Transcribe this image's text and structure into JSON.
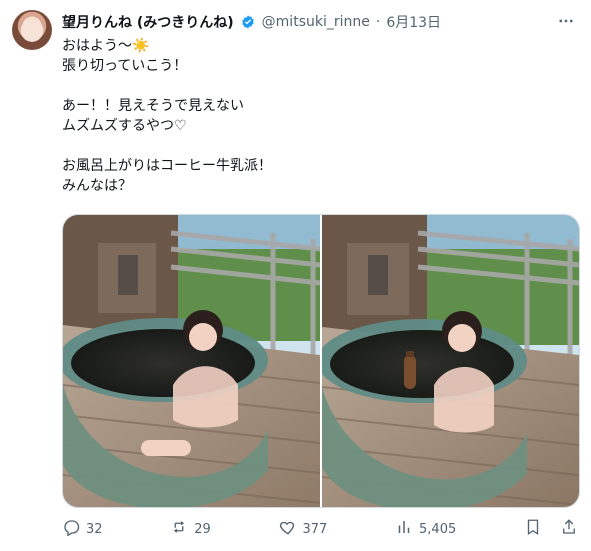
{
  "tweet": {
    "author_name": "望月りんね (みつきりんね)",
    "handle": "@mitsuki_rinne",
    "separator": "·",
    "date": "6月13日",
    "more_icon": "more-horizontal-icon",
    "verified_icon": "verified-badge-icon",
    "verified_color": "#1d9bf0",
    "text": "おはよう〜☀️\n張り切っていこう！\n\nあー！！見えそうで見えない\nムズムズするやつ♡\n\nお風呂上がりはコーヒー牛乳派！\nみんなは？"
  },
  "media": {
    "images": [
      {
        "label": "photo-1"
      },
      {
        "label": "photo-2"
      }
    ]
  },
  "actions": {
    "replies": "32",
    "retweets": "29",
    "likes": "377",
    "views": "5,405"
  },
  "colors": {
    "text_primary": "#0f1419",
    "text_secondary": "#536471",
    "border": "#cfd9de"
  }
}
